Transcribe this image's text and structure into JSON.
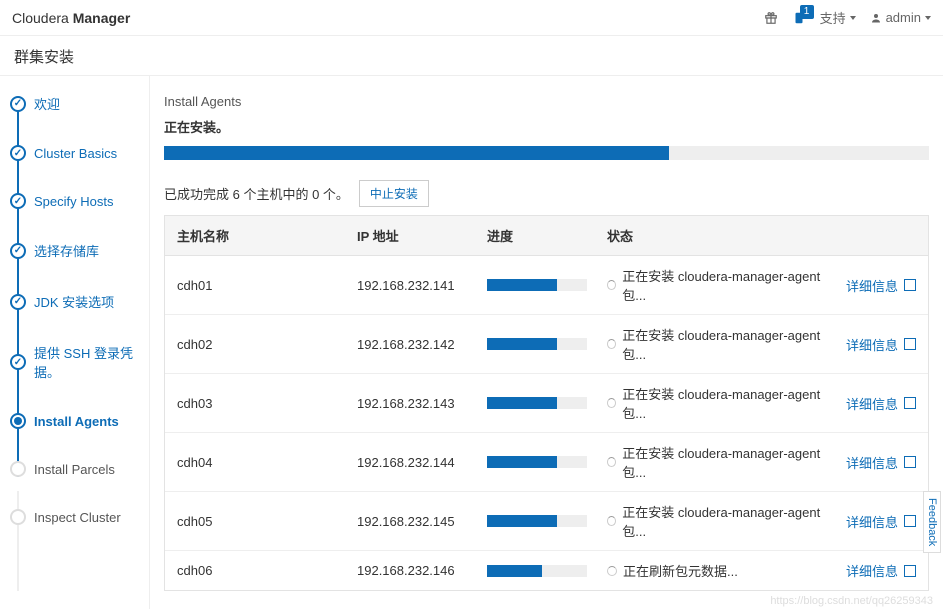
{
  "brand": {
    "light": "Cloudera ",
    "bold": "Manager"
  },
  "header": {
    "support": "支持",
    "badge": "1",
    "user": "admin"
  },
  "subhead": "群集安装",
  "sidebar": {
    "steps": [
      {
        "label": "欢迎",
        "state": "done"
      },
      {
        "label": "Cluster Basics",
        "state": "done"
      },
      {
        "label": "Specify Hosts",
        "state": "done"
      },
      {
        "label": "选择存储库",
        "state": "done"
      },
      {
        "label": "JDK 安装选项",
        "state": "done"
      },
      {
        "label": "提供 SSH 登录凭据。",
        "state": "done"
      },
      {
        "label": "Install Agents",
        "state": "current"
      },
      {
        "label": "Install Parcels",
        "state": "pending"
      },
      {
        "label": "Inspect Cluster",
        "state": "pending"
      }
    ]
  },
  "main": {
    "section_title": "Install Agents",
    "installing": "正在安装。",
    "overall_progress_pct": 66,
    "summary": "已成功完成 6 个主机中的 0 个。",
    "abort": "中止安装",
    "columns": {
      "host": "主机名称",
      "ip": "IP 地址",
      "progress": "进度",
      "status": "状态"
    },
    "detail_label": "详细信息",
    "rows": [
      {
        "host": "cdh01",
        "ip": "192.168.232.141",
        "progress": 70,
        "status": "正在安装 cloudera-manager-agent 包..."
      },
      {
        "host": "cdh02",
        "ip": "192.168.232.142",
        "progress": 70,
        "status": "正在安装 cloudera-manager-agent 包..."
      },
      {
        "host": "cdh03",
        "ip": "192.168.232.143",
        "progress": 70,
        "status": "正在安装 cloudera-manager-agent 包..."
      },
      {
        "host": "cdh04",
        "ip": "192.168.232.144",
        "progress": 70,
        "status": "正在安装 cloudera-manager-agent 包..."
      },
      {
        "host": "cdh05",
        "ip": "192.168.232.145",
        "progress": 70,
        "status": "正在安装 cloudera-manager-agent 包..."
      },
      {
        "host": "cdh06",
        "ip": "192.168.232.146",
        "progress": 55,
        "status": "正在刷新包元数据..."
      }
    ]
  },
  "feedback": "Feedback",
  "watermark": "https://blog.csdn.net/qq26259343"
}
